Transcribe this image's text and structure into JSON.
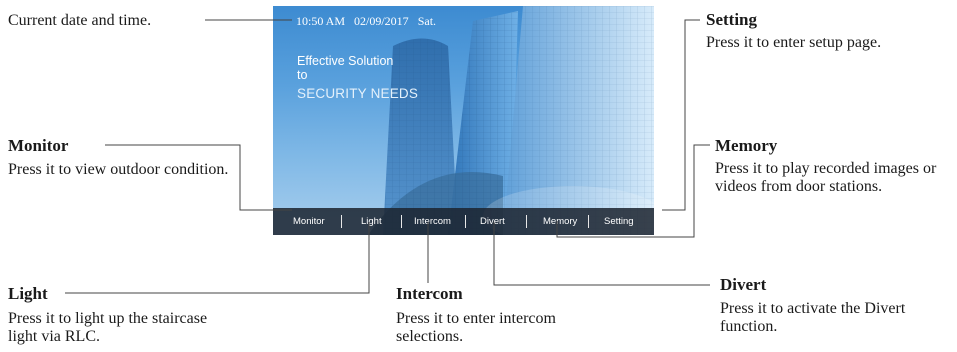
{
  "screen": {
    "status_time": "10:50 AM",
    "status_date": "02/09/2017",
    "status_day": "Sat.",
    "tagline_line1": "Effective Solution",
    "tagline_line2": "to",
    "tagline_line3": "SECURITY NEEDS",
    "menu": [
      "Monitor",
      "Light",
      "Intercom",
      "Divert",
      "Memory",
      "Setting"
    ]
  },
  "callouts": {
    "datetime": "Current date and time.",
    "setting": {
      "title": "Setting",
      "desc": "Press it to enter setup page."
    },
    "monitor": {
      "title": "Monitor",
      "desc": "Press it to view outdoor condition."
    },
    "memory": {
      "title": "Memory",
      "desc": "Press it to play recorded images or videos from door stations."
    },
    "light": {
      "title": "Light",
      "desc": "Press it to light up the staircase light via RLC."
    },
    "intercom": {
      "title": "Intercom",
      "desc": "Press it to enter intercom selections."
    },
    "divert": {
      "title": "Divert",
      "desc": "Press it to activate the Divert function."
    }
  },
  "colors": {
    "leader_line": "#444444",
    "menubar": "#1c2430",
    "sky": "#5aa1dd"
  }
}
